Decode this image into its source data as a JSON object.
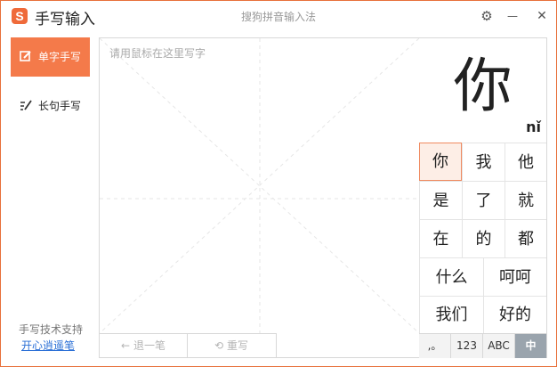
{
  "titlebar": {
    "logo_letter": "S",
    "title": "手写输入",
    "subtitle": "搜狗拼音输入法",
    "settings_icon": "⚙",
    "minimize_icon": "—",
    "close_icon": "✕"
  },
  "sidebar": {
    "modes": [
      {
        "label": "单字手写",
        "icon": "pen-square-icon"
      },
      {
        "label": "长句手写",
        "icon": "pen-lines-icon"
      }
    ],
    "support_text": "手写技术支持",
    "support_link": "开心逍遥笔"
  },
  "canvas": {
    "placeholder": "请用鼠标在这里写字",
    "undo_label": "退一笔",
    "rewrite_label": "重写"
  },
  "preview": {
    "character": "你",
    "pinyin": "nǐ"
  },
  "candidates": {
    "row1": [
      "你",
      "我",
      "他"
    ],
    "row2": [
      "是",
      "了",
      "就"
    ],
    "row3": [
      "在",
      "的",
      "都"
    ],
    "row4": [
      "什么",
      "呵呵"
    ],
    "row5": [
      "我们",
      "好的"
    ]
  },
  "keyboard_modes": [
    ",。",
    "123",
    "ABC",
    "中"
  ],
  "colors": {
    "accent": "#f47a4a",
    "active_mode": "#9aa4ad"
  }
}
